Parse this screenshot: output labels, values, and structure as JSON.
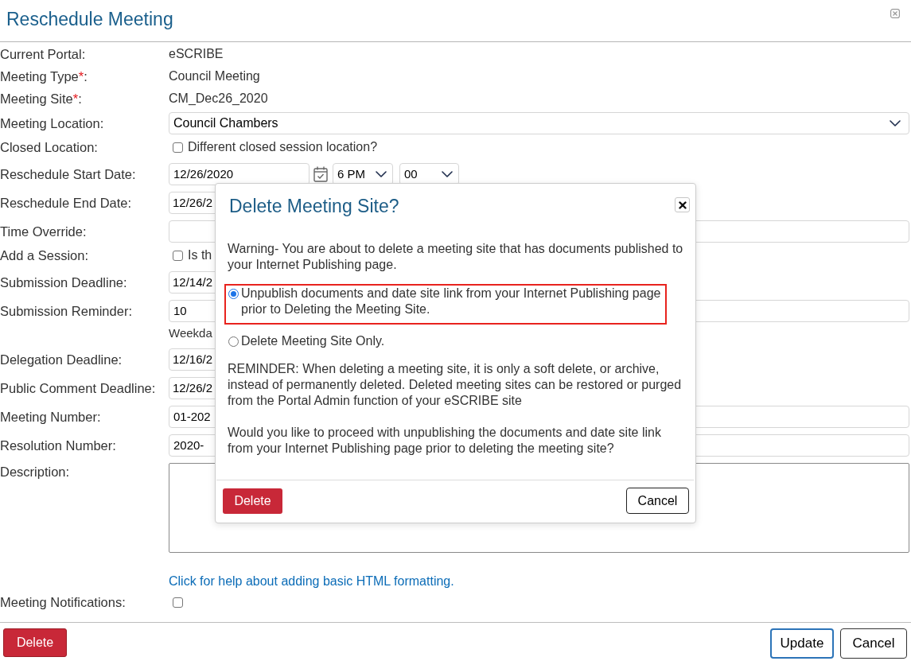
{
  "window": {
    "title": "Reschedule Meeting"
  },
  "form": {
    "fields": [
      {
        "kind": "text",
        "label": "Current Portal:",
        "value": "eSCRIBE"
      },
      {
        "kind": "text",
        "label": "Meeting Type",
        "required_mark": "*",
        "label_suffix": ":",
        "value": "Council Meeting"
      },
      {
        "kind": "text",
        "label": "Meeting Site",
        "required_mark": "*",
        "label_suffix": ":",
        "value": "CM_Dec26_2020"
      },
      {
        "kind": "select",
        "label": "Meeting Location:",
        "value": "Council Chambers"
      },
      {
        "kind": "checkbox",
        "label": "Closed Location:",
        "checked": false,
        "text": "Different closed session location?"
      },
      {
        "kind": "datetime",
        "label": "Reschedule Start Date:",
        "value": "12/26/2020",
        "hour": "6 PM",
        "minute": "00"
      },
      {
        "kind": "date",
        "label": "Reschedule End Date:",
        "value": "12/26/2"
      },
      {
        "kind": "input",
        "label": "Time Override:"
      },
      {
        "kind": "checkbox",
        "label": "Add a Session:",
        "checked": false,
        "text": "Is th"
      },
      {
        "kind": "date",
        "label": "Submission Deadline:",
        "value": "12/14/2"
      },
      {
        "kind": "input",
        "label": "Submission Reminder:",
        "value": "10",
        "note": "Weekda"
      },
      {
        "kind": "date",
        "label": "Delegation Deadline:",
        "value": "12/16/2"
      },
      {
        "kind": "date",
        "label": "Public Comment Deadline:",
        "value": "12/26/2"
      },
      {
        "kind": "input",
        "label": "Meeting Number:",
        "value": "01-202"
      },
      {
        "kind": "input",
        "label": "Resolution Number:",
        "value": "2020-"
      },
      {
        "kind": "textarea",
        "label": "Description:"
      },
      {
        "kind": "link",
        "text": "Click for help about adding basic HTML formatting."
      },
      {
        "kind": "checkbox",
        "label": "Meeting Notifications:",
        "checked": false
      }
    ]
  },
  "footer": {
    "buttons": [
      {
        "label": "Delete",
        "kind": "danger"
      },
      {
        "label": "Update",
        "kind": "primary"
      },
      {
        "label": "Cancel",
        "kind": "secondary"
      }
    ]
  },
  "dialog": {
    "title": "Delete Meeting Site?",
    "warning": "Warning- You are about to delete a meeting site that has documents published to your Internet Publishing page.",
    "options": [
      {
        "label": "Unpublish documents and date site link from your Internet Publishing page prior to Deleting the Meeting Site.",
        "selected": true,
        "highlighted": true
      },
      {
        "label": "Delete Meeting Site Only.",
        "selected": false,
        "highlighted": false
      }
    ],
    "reminder": "REMINDER: When deleting a meeting site, it is only a soft delete, or archive, instead of permanently deleted. Deleted meeting sites can be restored or purged from the Portal Admin function of your eSCRIBE site",
    "question": "Would you like to proceed with unpublishing the documents and date site link from your Internet Publishing page prior to deleting the meeting site?",
    "buttons": [
      {
        "label": "Delete",
        "kind": "danger"
      },
      {
        "label": "Cancel",
        "kind": "secondary"
      }
    ]
  }
}
